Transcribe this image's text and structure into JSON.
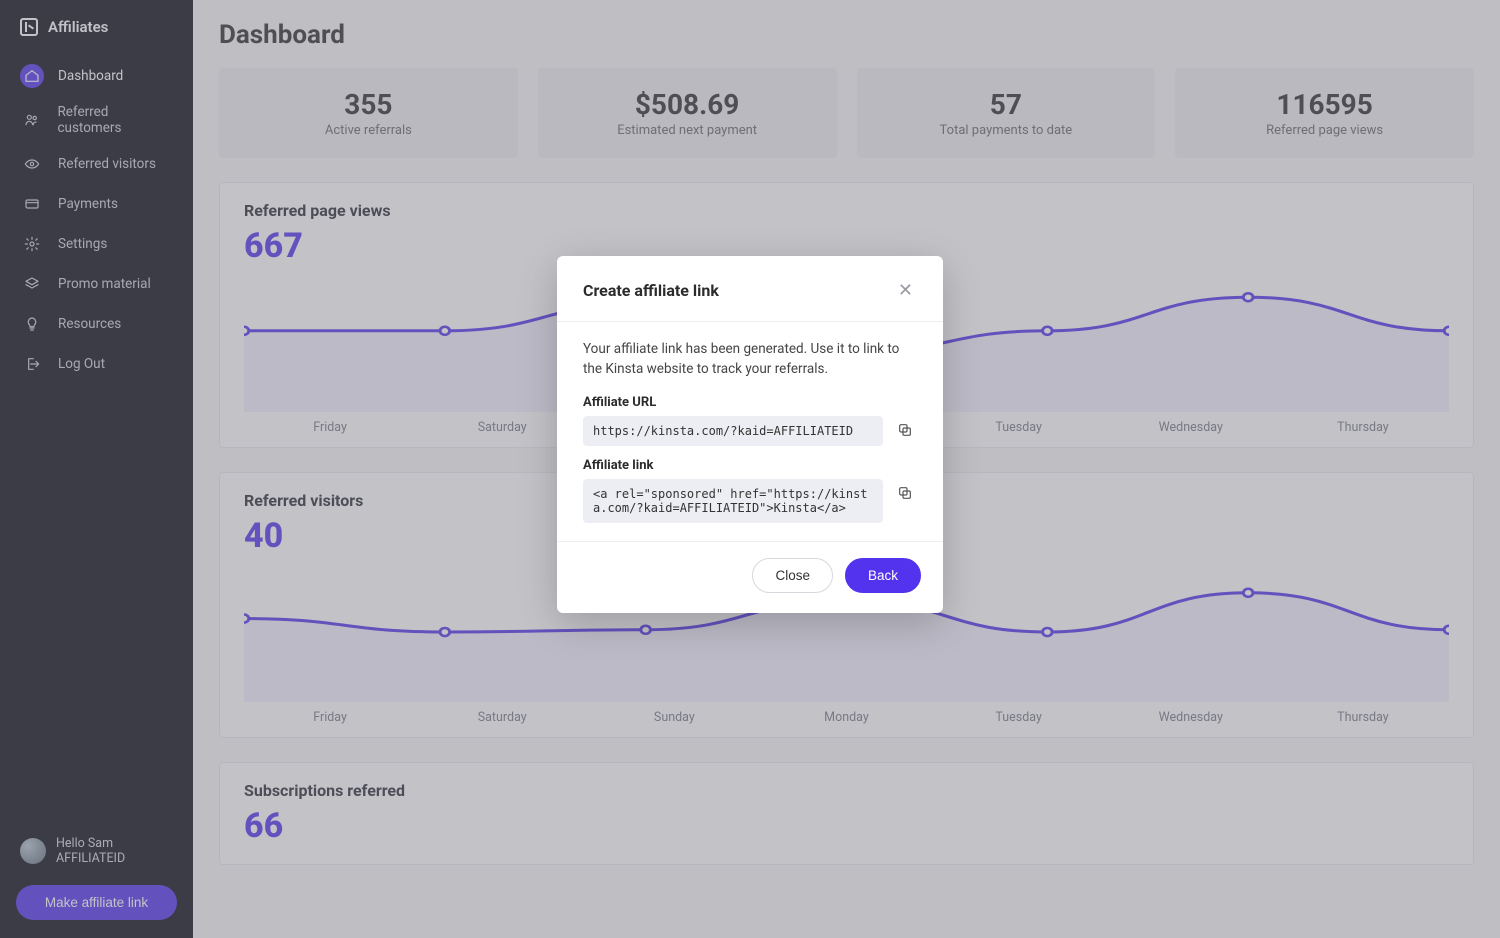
{
  "brand": "Affiliates",
  "sidebar": {
    "items": [
      {
        "icon": "home",
        "label": "Dashboard",
        "active": true
      },
      {
        "icon": "users",
        "label": "Referred customers",
        "active": false
      },
      {
        "icon": "eye",
        "label": "Referred visitors",
        "active": false
      },
      {
        "icon": "card",
        "label": "Payments",
        "active": false
      },
      {
        "icon": "gear",
        "label": "Settings",
        "active": false
      },
      {
        "icon": "layers",
        "label": "Promo material",
        "active": false
      },
      {
        "icon": "bulb",
        "label": "Resources",
        "active": false
      },
      {
        "icon": "logout",
        "label": "Log Out",
        "active": false
      }
    ]
  },
  "user": {
    "greeting": "Hello Sam",
    "affiliate_id": "AFFILIATEID"
  },
  "make_link_btn": "Make affiliate link",
  "page_title": "Dashboard",
  "stats": [
    {
      "value": "355",
      "label": "Active referrals"
    },
    {
      "value": "$508.69",
      "label": "Estimated next payment"
    },
    {
      "value": "57",
      "label": "Total payments to date"
    },
    {
      "value": "116595",
      "label": "Referred page views"
    }
  ],
  "days": [
    "Friday",
    "Saturday",
    "Sunday",
    "Monday",
    "Tuesday",
    "Wednesday",
    "Thursday"
  ],
  "panels": {
    "pageviews": {
      "title": "Referred page views",
      "big": "667"
    },
    "visitors": {
      "title": "Referred visitors",
      "big": "40"
    },
    "subs": {
      "title": "Subscriptions referred",
      "big": "66"
    }
  },
  "chart_data": [
    {
      "type": "line",
      "title": "Referred page views",
      "categories": [
        "Friday",
        "Saturday",
        "Sunday",
        "Monday",
        "Tuesday",
        "Wednesday",
        "Thursday"
      ],
      "series": [
        {
          "name": "page views",
          "values": [
            60,
            60,
            85,
            40,
            60,
            90,
            60
          ]
        }
      ],
      "ylim": [
        0,
        100
      ],
      "total": 667
    },
    {
      "type": "line",
      "title": "Referred visitors",
      "categories": [
        "Friday",
        "Saturday",
        "Sunday",
        "Monday",
        "Tuesday",
        "Wednesday",
        "Thursday"
      ],
      "series": [
        {
          "name": "visitors",
          "values": [
            62,
            50,
            52,
            78,
            50,
            85,
            52
          ]
        }
      ],
      "ylim": [
        0,
        100
      ],
      "total": 40
    }
  ],
  "modal": {
    "title": "Create affiliate link",
    "desc": "Your affiliate link has been generated. Use it to link to the Kinsta website to track your referrals.",
    "url_label": "Affiliate URL",
    "url_value": "https://kinsta.com/?kaid=AFFILIATEID",
    "link_label": "Affiliate link",
    "link_value": "<a rel=\"sponsored\" href=\"https://kinsta.com/?kaid=AFFILIATEID\">Kinsta</a>",
    "close": "Close",
    "back": "Back"
  },
  "colors": {
    "accent": "#5333ed"
  }
}
